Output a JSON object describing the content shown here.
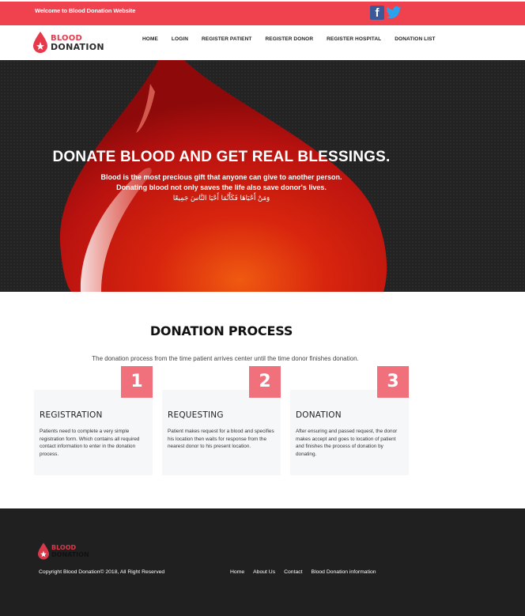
{
  "topbar": {
    "welcome": "Welcome to Blood Donation Website"
  },
  "social": {
    "facebook_glyph": "f",
    "facebook_icon": "facebook-icon",
    "twitter_icon": "twitter-icon"
  },
  "logo": {
    "line1": "BLOOD",
    "line2": "DONATION"
  },
  "nav": [
    "HOME",
    "LOGIN",
    "REGISTER PATIENT",
    "REGISTER DONOR",
    "REGISTER HOSPITAL",
    "DONATION LIST"
  ],
  "hero": {
    "title": "DONATE BLOOD AND GET REAL BLESSINGS.",
    "line1": "Blood is the most precious gift that anyone can give to another person.",
    "line2": "Donating blood not only saves the life also save donor's lives.",
    "arabic": "وَمَنْ أَحْيَاهَا فَكَأَنَّمَا أَحْيَا النَّاسَ جَمِيعًا"
  },
  "process": {
    "title": "DONATION PROCESS",
    "description": "The donation process from the time patient arrives center until the time donor finishes donation.",
    "cards": [
      {
        "num": "1",
        "title": "REGISTRATION",
        "text": "Patients need to complete a very simple registration form. Which contains all required contact information to enter in the donation process."
      },
      {
        "num": "2",
        "title": "REQUESTING",
        "text": "Patient makes request for a blood and specifies his location then waits for response from the nearest donor to his present location."
      },
      {
        "num": "3",
        "title": "DONATION",
        "text": "After ensuring and passed request, the donor makes accept and goes to location of patient and finishes the process of donation by donating."
      }
    ]
  },
  "footer": {
    "logo_line1": "BLOOD",
    "logo_line2": "DONATION",
    "copyright": "Copyright Blood Donation© 2018, All Right Reserved",
    "links": [
      "Home",
      "About Us",
      "Contact",
      "Blood Donation information"
    ]
  },
  "colors": {
    "accent": "#f0414f",
    "card_number": "#f0707c",
    "footer_bg": "#202020",
    "hero_bg": "#232323"
  }
}
